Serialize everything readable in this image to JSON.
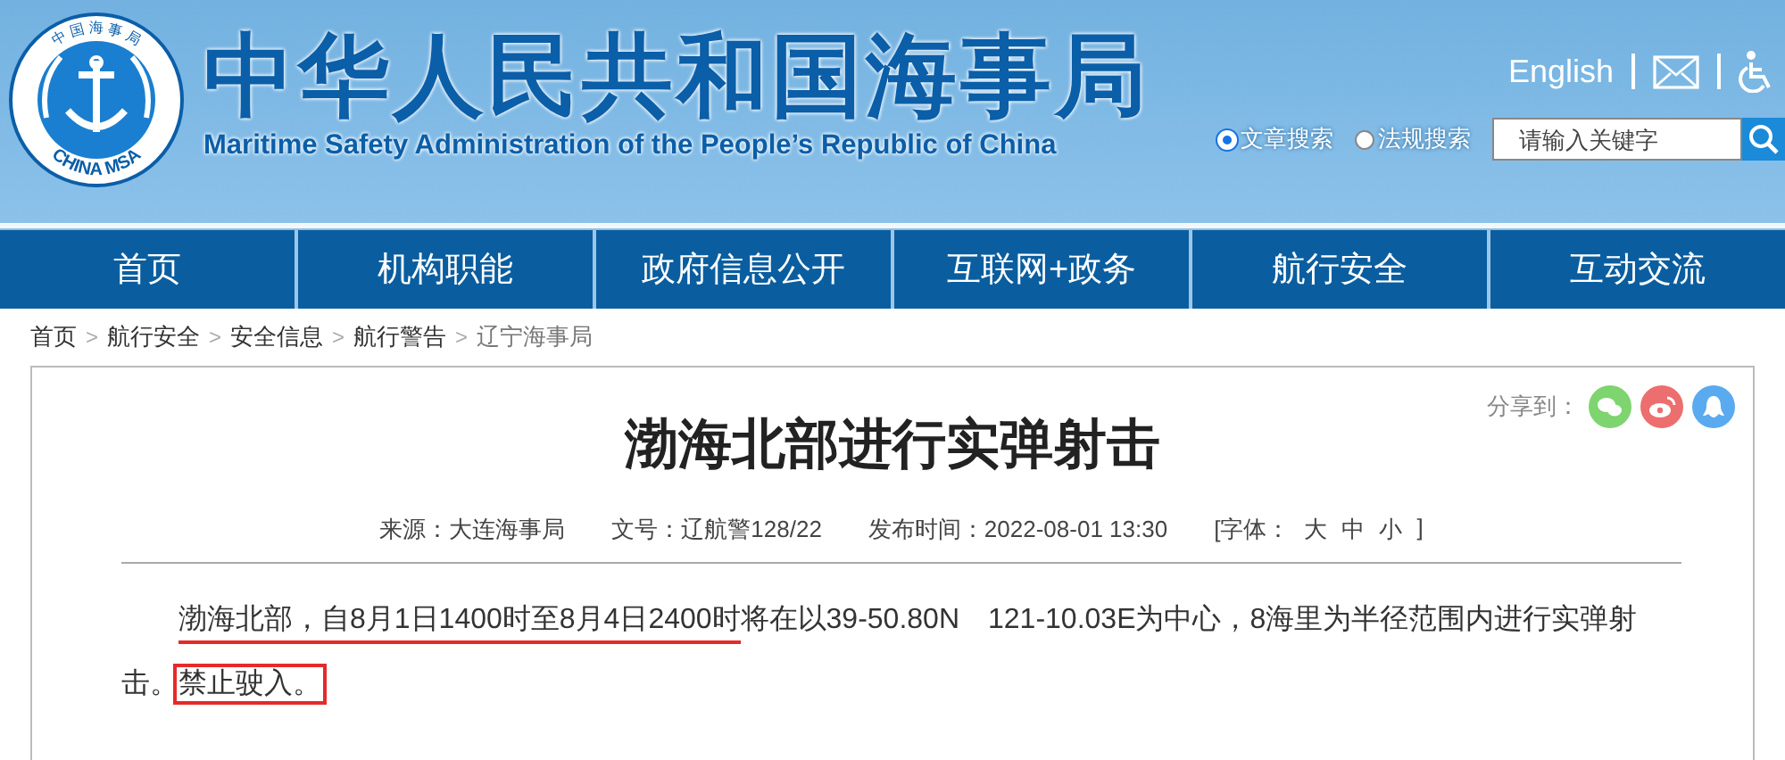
{
  "header": {
    "logo_ring_text": "中 国 海 事 局",
    "logo_bottom_text": "CHINA MSA",
    "title": "中华人民共和国海事局",
    "subtitle": "Maritime Safety Administration of the People’s Republic of China",
    "english_link": "English",
    "search_scopes": [
      {
        "label": "文章搜索",
        "selected": true
      },
      {
        "label": "法规搜索",
        "selected": false
      }
    ],
    "search": {
      "placeholder": "请输入关键字"
    }
  },
  "nav": [
    {
      "label": "首页"
    },
    {
      "label": "机构职能"
    },
    {
      "label": "政府信息公开"
    },
    {
      "label": "互联网+政务"
    },
    {
      "label": "航行安全"
    },
    {
      "label": "互动交流"
    }
  ],
  "breadcrumb": [
    {
      "label": "首页",
      "current": false
    },
    {
      "label": "航行安全",
      "current": false
    },
    {
      "label": "安全信息",
      "current": false
    },
    {
      "label": "航行警告",
      "current": false
    },
    {
      "label": "辽宁海事局",
      "current": true
    }
  ],
  "breadcrumb_separator": ">",
  "article": {
    "share_label": "分享到：",
    "share": [
      {
        "kind": "wechat",
        "color": "#7ed46f"
      },
      {
        "kind": "weibo",
        "color": "#ec6e6e"
      },
      {
        "kind": "qq",
        "color": "#5aaaf0"
      }
    ],
    "title": "渤海北部进行实弹射击",
    "meta": [
      {
        "kind": "text",
        "text": "来源：大连海事局"
      },
      {
        "kind": "text",
        "text": "文号：辽航警128/22"
      },
      {
        "kind": "text",
        "text": "发布时间：2022-08-01 13:30"
      },
      {
        "kind": "fontsize",
        "label": "[字体：",
        "sizes": [
          "大",
          "中",
          "小"
        ],
        "end": "]"
      }
    ],
    "body": [
      {
        "text": "渤海北部，自8月1日1400时至8月4日2400时",
        "underlined": true,
        "boxed": false
      },
      {
        "text": "将在以39-50.80N　121-10.03E为中心，8海里为半径范围内进行实弹射击。",
        "underlined": false,
        "boxed": false
      },
      {
        "text": "禁止驶入。",
        "underlined": false,
        "boxed": true
      }
    ]
  }
}
